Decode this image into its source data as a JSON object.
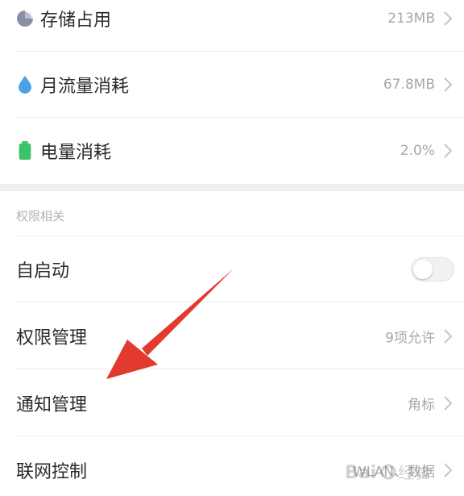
{
  "rows_top": [
    {
      "label": "存储占用",
      "value": "213MB",
      "icon": "pie-chart-icon"
    },
    {
      "label": "月流量消耗",
      "value": "67.8MB",
      "icon": "water-drop-icon"
    },
    {
      "label": "电量消耗",
      "value": "2.0%",
      "icon": "battery-icon"
    }
  ],
  "section": {
    "header": "权限相关"
  },
  "rows_perm": [
    {
      "label": "自启动",
      "toggle_on": false
    },
    {
      "label": "权限管理",
      "value": "9项允许"
    },
    {
      "label": "通知管理",
      "value": "角标"
    },
    {
      "label": "联网控制",
      "value": "WLAN、数据"
    }
  ],
  "colors": {
    "pie_icon": "#8a8fa6",
    "drop_icon": "#4aa3e6",
    "battery_icon": "#3cc26b",
    "annotation_arrow": "#e23a2e"
  },
  "annotation": {
    "type": "red-arrow",
    "points_to": "通知管理"
  }
}
